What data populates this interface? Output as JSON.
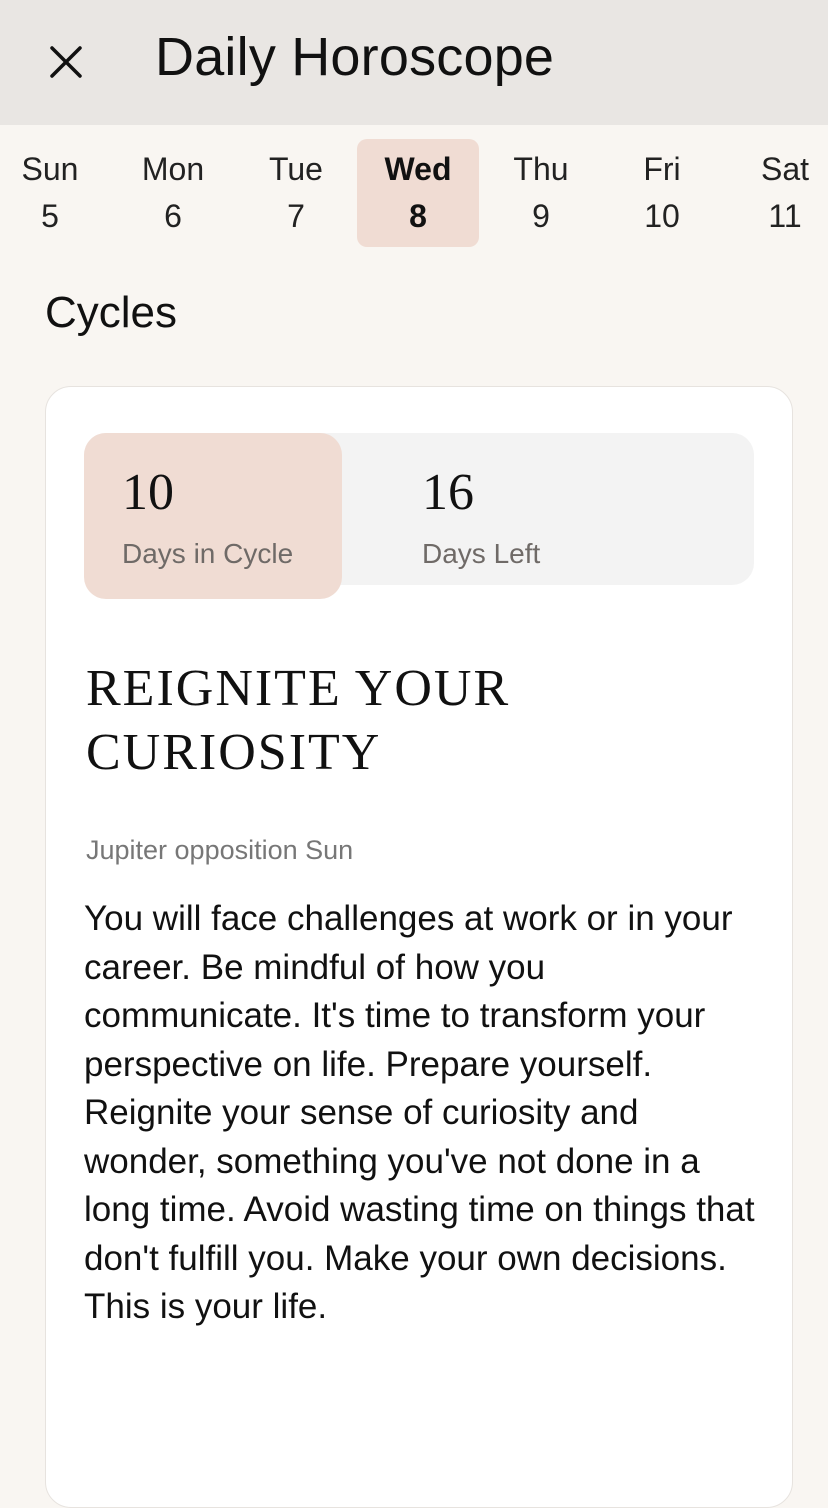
{
  "header": {
    "title": "Daily Horoscope",
    "close_icon": "close-icon"
  },
  "week": {
    "days": [
      {
        "name": "Sun",
        "date": "5",
        "selected": false
      },
      {
        "name": "Mon",
        "date": "6",
        "selected": false
      },
      {
        "name": "Tue",
        "date": "7",
        "selected": false
      },
      {
        "name": "Wed",
        "date": "8",
        "selected": true
      },
      {
        "name": "Thu",
        "date": "9",
        "selected": false
      },
      {
        "name": "Fri",
        "date": "10",
        "selected": false
      },
      {
        "name": "Sat",
        "date": "11",
        "selected": false
      }
    ]
  },
  "section": {
    "title": "Cycles"
  },
  "cycle": {
    "days_in_cycle": "10",
    "days_in_cycle_label": "Days in Cycle",
    "days_left": "16",
    "days_left_label": "Days Left",
    "headline": "REIGNITE YOUR CURIOSITY",
    "aspect": "Jupiter opposition Sun",
    "body": "You will face challenges at work or in your career. Be mindful of how you communicate. It's time to transform your perspective on life. Prepare yourself. Reignite your sense of curiosity and wonder, something you've not done in a long time. Avoid wasting time on things that don't fulfill you. Make your own decisions. This is your life."
  },
  "colors": {
    "header_bg": "#e9e6e3",
    "page_bg": "#f9f6f2",
    "accent": "#f0dcd3"
  }
}
